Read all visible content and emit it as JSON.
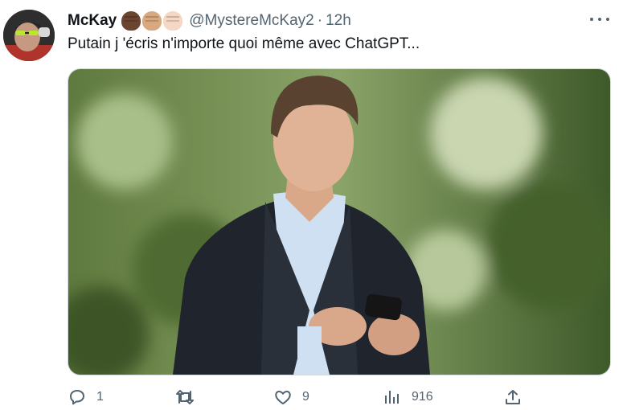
{
  "tweet": {
    "author_name": "McKay",
    "handle": "@MystereMcKay2",
    "separator": "·",
    "time": "12h",
    "text": "Putain j 'écris n'importe quoi même avec ChatGPT...",
    "emoji_skin_tones": [
      "#6b4530",
      "#d9a87e",
      "#f5d7c4"
    ]
  },
  "actions": {
    "reply_count": "1",
    "retweet_count": "",
    "like_count": "9",
    "views_count": "916"
  },
  "colors": {
    "secondary_text": "#536471",
    "primary_text": "#0f1419"
  },
  "icons": [
    "more-icon",
    "reply-icon",
    "retweet-icon",
    "like-icon",
    "views-icon",
    "share-icon"
  ]
}
